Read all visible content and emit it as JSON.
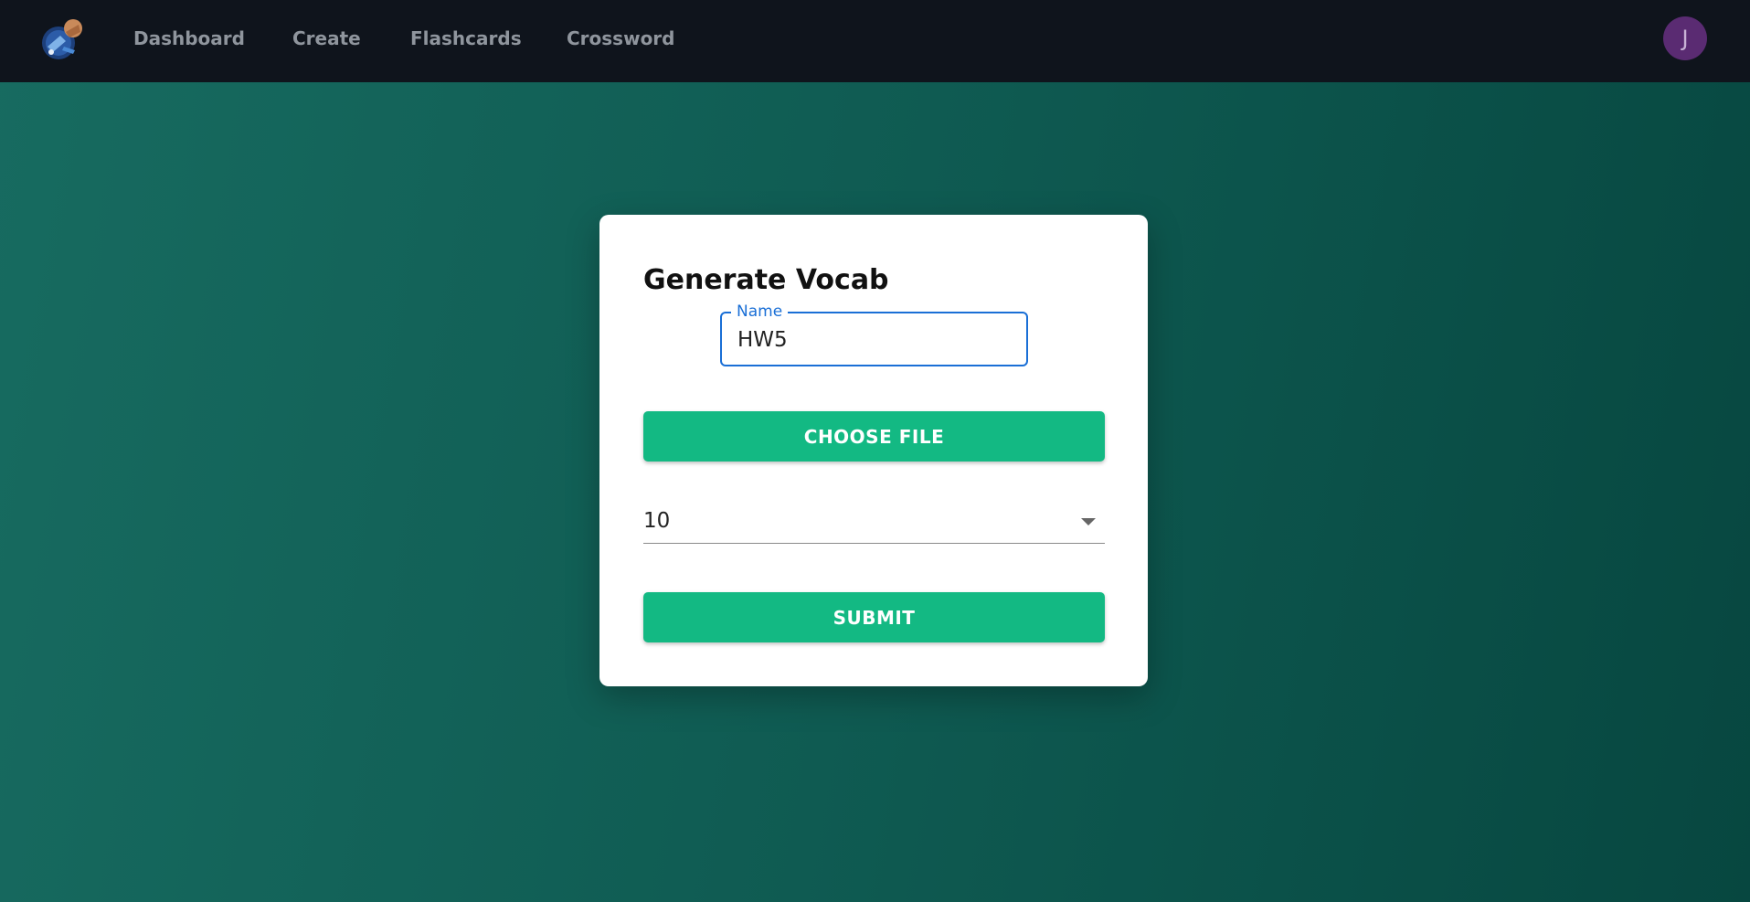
{
  "nav": {
    "links": [
      "Dashboard",
      "Create",
      "Flashcards",
      "Crossword"
    ],
    "avatar_initial": "J",
    "logo_icon": "rocket-astronaut-logo"
  },
  "form": {
    "title": "Generate Vocab",
    "name_label": "Name",
    "name_value": "HW5",
    "choose_file_label": "CHOOSE FILE",
    "count_value": "10",
    "submit_label": "SUBMIT"
  },
  "colors": {
    "nav_bg": "#0f141c",
    "accent_button": "#13b983",
    "focus_blue": "#1a6fd6",
    "avatar_bg": "#5a2b72",
    "page_bg": "#0f5b52"
  }
}
